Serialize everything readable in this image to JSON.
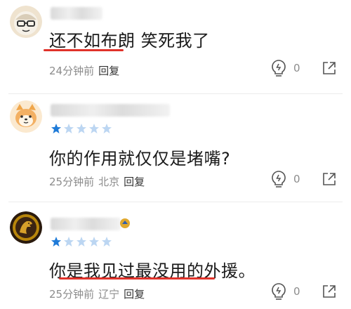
{
  "comments": [
    {
      "text_marked": "还不如布朗",
      "text_rest": " 笑死我了",
      "time": "24分钟前",
      "location": "",
      "reply_label": "回复",
      "like_count": "0",
      "rating": null
    },
    {
      "text_full": "你的作用就仅仅是堵嘴?",
      "time": "25分钟前",
      "location": "北京",
      "reply_label": "回复",
      "like_count": "0",
      "rating": 1
    },
    {
      "text_full": "你是我见过最没用的外援。",
      "time": "25分钟前",
      "location": "辽宁",
      "reply_label": "回复",
      "like_count": "0",
      "rating": 1
    }
  ],
  "colors": {
    "underline": "#e0322a",
    "star_filled": "#1f7bd8",
    "star_empty": "#bcd6f2",
    "meta_text": "#8c8c8c"
  },
  "icons": [
    "avatar-glasses-cat",
    "avatar-shiba",
    "avatar-jurassic",
    "star-icon",
    "lightbulb-like-icon",
    "share-icon"
  ]
}
